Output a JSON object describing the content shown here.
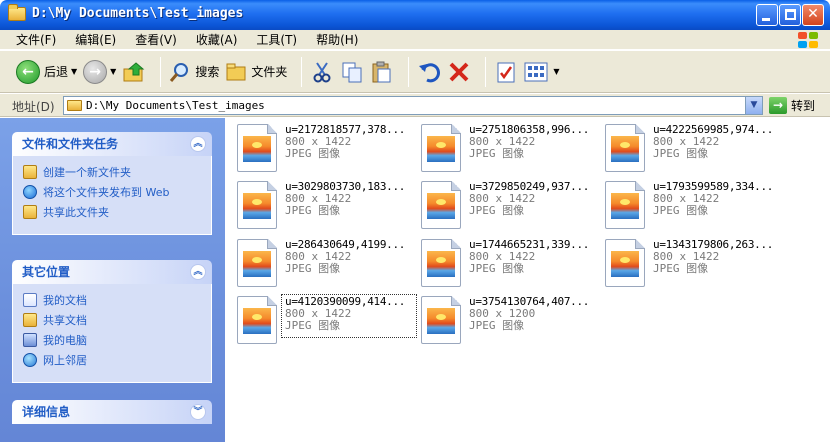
{
  "window": {
    "title": "D:\\My Documents\\Test_images"
  },
  "menu": [
    "文件(F)",
    "编辑(E)",
    "查看(V)",
    "收藏(A)",
    "工具(T)",
    "帮助(H)"
  ],
  "toolbar": {
    "back_label": "后退",
    "search_label": "搜索",
    "folders_label": "文件夹"
  },
  "address": {
    "label": "地址(D)",
    "path": "D:\\My Documents\\Test_images",
    "go_label": "转到"
  },
  "left_pane": {
    "tasks_title": "文件和文件夹任务",
    "tasks": [
      "创建一个新文件夹",
      "将这个文件夹发布到 Web",
      "共享此文件夹"
    ],
    "places_title": "其它位置",
    "places": [
      "我的文档",
      "共享文档",
      "我的电脑",
      "网上邻居"
    ],
    "details_title": "详细信息"
  },
  "files": [
    {
      "name": "u=2172818577,378...",
      "dims": "800 x 1422",
      "type": "JPEG 图像"
    },
    {
      "name": "u=2751806358,996...",
      "dims": "800 x 1422",
      "type": "JPEG 图像"
    },
    {
      "name": "u=4222569985,974...",
      "dims": "800 x 1422",
      "type": "JPEG 图像"
    },
    {
      "name": "u=3029803730,183...",
      "dims": "800 x 1422",
      "type": "JPEG 图像"
    },
    {
      "name": "u=3729850249,937...",
      "dims": "800 x 1422",
      "type": "JPEG 图像"
    },
    {
      "name": "u=1793599589,334...",
      "dims": "800 x 1422",
      "type": "JPEG 图像"
    },
    {
      "name": "u=286430649,4199...",
      "dims": "800 x 1422",
      "type": "JPEG 图像"
    },
    {
      "name": "u=1744665231,339...",
      "dims": "800 x 1422",
      "type": "JPEG 图像"
    },
    {
      "name": "u=1343179806,263...",
      "dims": "800 x 1422",
      "type": "JPEG 图像"
    },
    {
      "name": "u=4120390099,414...",
      "dims": "800 x 1422",
      "type": "JPEG 图像",
      "selected": true
    },
    {
      "name": "u=3754130764,407...",
      "dims": "800 x 1200",
      "type": "JPEG 图像"
    }
  ]
}
